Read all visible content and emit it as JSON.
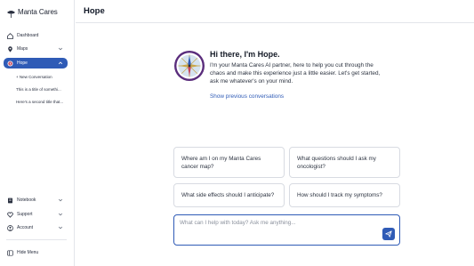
{
  "app": {
    "brand_name": "Manta Cares"
  },
  "sidebar": {
    "items": [
      {
        "label": "Dashboard",
        "icon": "home-icon"
      },
      {
        "label": "Maps",
        "icon": "map-pin-icon"
      },
      {
        "label": "Hope",
        "icon": "compass-icon"
      },
      {
        "label": "Notebook",
        "icon": "notebook-icon"
      },
      {
        "label": "Support",
        "icon": "heart-icon"
      },
      {
        "label": "Account",
        "icon": "user-icon"
      },
      {
        "label": "Hide Menu",
        "icon": "hide-menu-icon"
      }
    ],
    "sub_items": [
      {
        "label": "+ New Conversation"
      },
      {
        "label": "This is a title of somethi..."
      },
      {
        "label": "Here's a second title that..."
      }
    ]
  },
  "header": {
    "title": "Hope"
  },
  "intro": {
    "greeting": "Hi there, I'm Hope.",
    "body": "I'm your Manta Cares AI partner, here to help you cut through the chaos and make this experience just a little easier. Let's get started, ask me whatever's on your mind.",
    "previous_link": "Show previous conversations"
  },
  "suggestions": [
    {
      "text": "Where am I on my Manta Cares cancer map?"
    },
    {
      "text": "What questions should I ask my oncologist?"
    },
    {
      "text": "What side effects should I anticipate?"
    },
    {
      "text": "How should I track my symptoms?"
    }
  ],
  "chat": {
    "placeholder": "What can I help with today? Ask me anything..."
  },
  "colors": {
    "accent": "#2f5bb6",
    "avatar_ring": "#5a2d7c",
    "border": "#d8dbe2"
  }
}
